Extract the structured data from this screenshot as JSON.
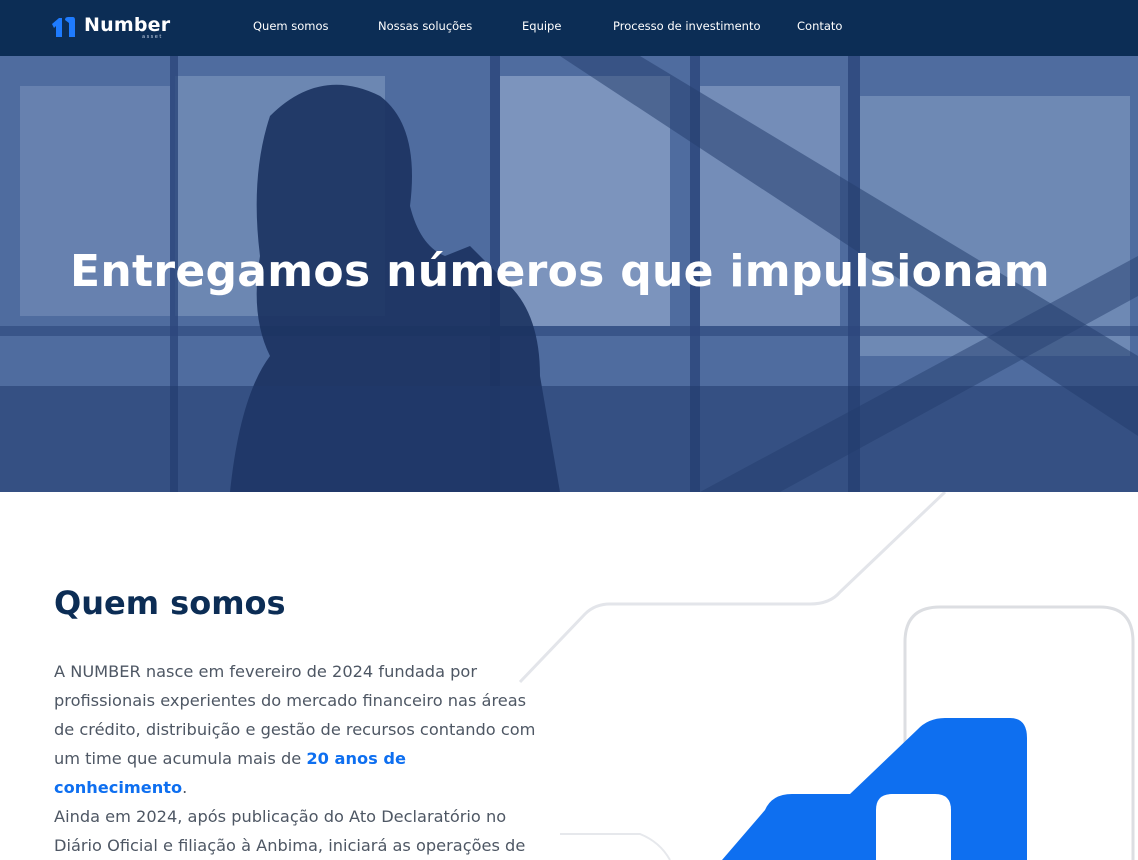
{
  "brand": {
    "name": "Number",
    "sub": "asset",
    "accent_color": "#0e6ff0",
    "navy_color": "#0c2d55"
  },
  "nav": {
    "items": [
      {
        "label": "Quem somos"
      },
      {
        "label": "Nossas soluções"
      },
      {
        "label": "Equipe"
      },
      {
        "label": "Processo de investimento"
      },
      {
        "label": "Contato"
      }
    ]
  },
  "hero": {
    "title": "Entregamos números que impulsionam"
  },
  "about": {
    "title": "Quem somos",
    "p1_before": "A NUMBER nasce em fevereiro de 2024 fundada por profissionais experientes do mercado financeiro nas áreas de crédito, distribuição e gestão de recursos contando com um time que acumula mais de ",
    "p1_highlight": "20 anos de conhecimento",
    "p1_after": ".",
    "p2": "Ainda em 2024, após publicação do Ato Declaratório no Diário Oficial e filiação à Anbima, iniciará as operações de gestão de"
  }
}
